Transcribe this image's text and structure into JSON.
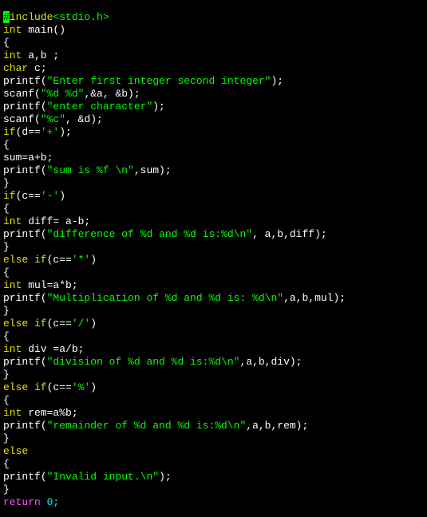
{
  "topbar": {
    "left": "",
    "right": ""
  },
  "code": {
    "kw_include": "include",
    "hdr_open": "<stdio.h>",
    "kw_int": "int",
    "main_sig": " main()",
    "brace_open": "{",
    "brace_close": "}",
    "decl_ab": " a,b ;",
    "kw_char": "char",
    "decl_c": " c;",
    "fn_printf": "printf",
    "fn_scanf": "scanf",
    "p_open": "(",
    "p_close_semi": ");",
    "p_close_semi2": ");",
    "str_prompt1": "\"Enter first integer second integer\"",
    "str_scan1": "\"%d %d\"",
    "scan1_args": ",&a, &b);",
    "str_prompt2": "\"enter character\"",
    "str_scan2": "\"%c\"",
    "scan2_args": ", &d);",
    "kw_if": "if",
    "cond_plus_a": "(d==",
    "lit_plus": "'+'",
    "cond_plus_b": ");",
    "sum_assign": "sum=a+b;",
    "str_sum": "\"sum is %f \\n\"",
    "sum_args": ",sum);",
    "cond_minus_a": "(c==",
    "lit_minus": "'-'",
    "cond_close": ")",
    "diff_decl": " diff= a-b;",
    "str_diff": "\"difference of %d and %d is:%d\\n\"",
    "diff_args": ", a,b,diff);",
    "kw_else": "else",
    "kw_elseif": "else if",
    "lit_star": "'*'",
    "mul_decl": " mul=a*b;",
    "str_mul": "\"Multiplication of %d and %d is: %d\\n\"",
    "mul_args": ",a,b,mul);",
    "lit_slash": "'/'",
    "div_decl": " div =a/b;",
    "str_div": "\"division of %d and %d is:%d\\n\"",
    "div_args": ",a,b,div);",
    "lit_pct": "'%'",
    "rem_decl": " rem=a%b;",
    "str_rem": "\"remainder of %d and %d is:%d\\n\"",
    "rem_args": ",a,b,rem);",
    "str_invalid": "\"Invalid input.\\n\"",
    "kw_return": "return",
    "ret_val": " 0;"
  }
}
